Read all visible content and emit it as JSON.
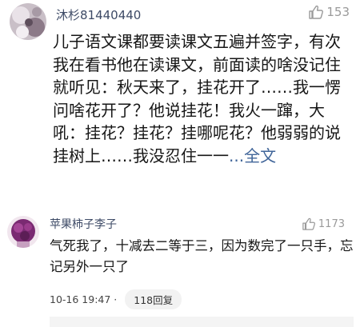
{
  "comments": [
    {
      "username": "沐杉81440440",
      "likes": "153",
      "text": "儿子语文课都要读课文五遍并签字，有次我在看书他在读课文，前面读的啥没记住就听见：秋天来了，挂花开了……我一愣问啥花开了？他说挂花！我火一蹿，大吼：挂花？挂花？挂哪呢花？他弱弱的说挂树上……我没忍住一一",
      "more_link": "...全文"
    },
    {
      "username": "苹果柿子李子",
      "likes": "1173",
      "text": "气死我了，十减去二等于三，因为数完了一只手，忘记另外一只了",
      "time": "10-16 19:47 ·",
      "reply_label": "118回复"
    }
  ],
  "colors": {
    "username": "#3d4a66",
    "link": "#406599",
    "meta_gray": "#9a9a9a"
  }
}
